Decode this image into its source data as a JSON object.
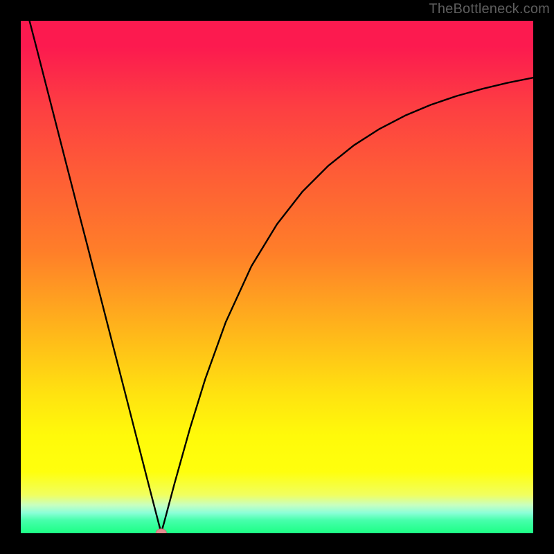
{
  "watermark": {
    "text": "TheBottleneck.com"
  },
  "colors": {
    "bg_black": "#000000",
    "curve": "#000000",
    "marker_fill": "#e38b8f",
    "marker_stroke": "#c86e74",
    "gradient_stops": [
      "#fc1a4f",
      "#fd3f42",
      "#fe5d36",
      "#ff7e29",
      "#ffb41b",
      "#ffe310",
      "#fffa0a",
      "#ffff0d",
      "#f1ff5f",
      "#c8ffc0",
      "#8cffd8",
      "#46ffab",
      "#1cff85"
    ]
  },
  "chart_data": {
    "type": "line",
    "title": "",
    "xlabel": "",
    "ylabel": "",
    "xlim": [
      0,
      100
    ],
    "ylim": [
      0,
      100
    ],
    "grid": false,
    "legend": false,
    "series": [
      {
        "name": "curve",
        "x": [
          1.7,
          3,
          5,
          7,
          9,
          11,
          13,
          15,
          17,
          19,
          21,
          23,
          25,
          27,
          27.4,
          28,
          30,
          33,
          36,
          40,
          45,
          50,
          55,
          60,
          65,
          70,
          75,
          80,
          85,
          90,
          95,
          100
        ],
        "values": [
          100,
          95,
          87.2,
          79.4,
          71.6,
          63.8,
          56.1,
          48.3,
          40.5,
          32.7,
          24.9,
          17.1,
          9.3,
          1.6,
          0.1,
          2.2,
          9.7,
          20.4,
          30.1,
          41.2,
          52.1,
          60.3,
          66.7,
          71.7,
          75.7,
          78.9,
          81.5,
          83.6,
          85.3,
          86.7,
          87.9,
          88.9
        ]
      }
    ],
    "marker": {
      "x": 27.4,
      "y": 0.1
    }
  }
}
